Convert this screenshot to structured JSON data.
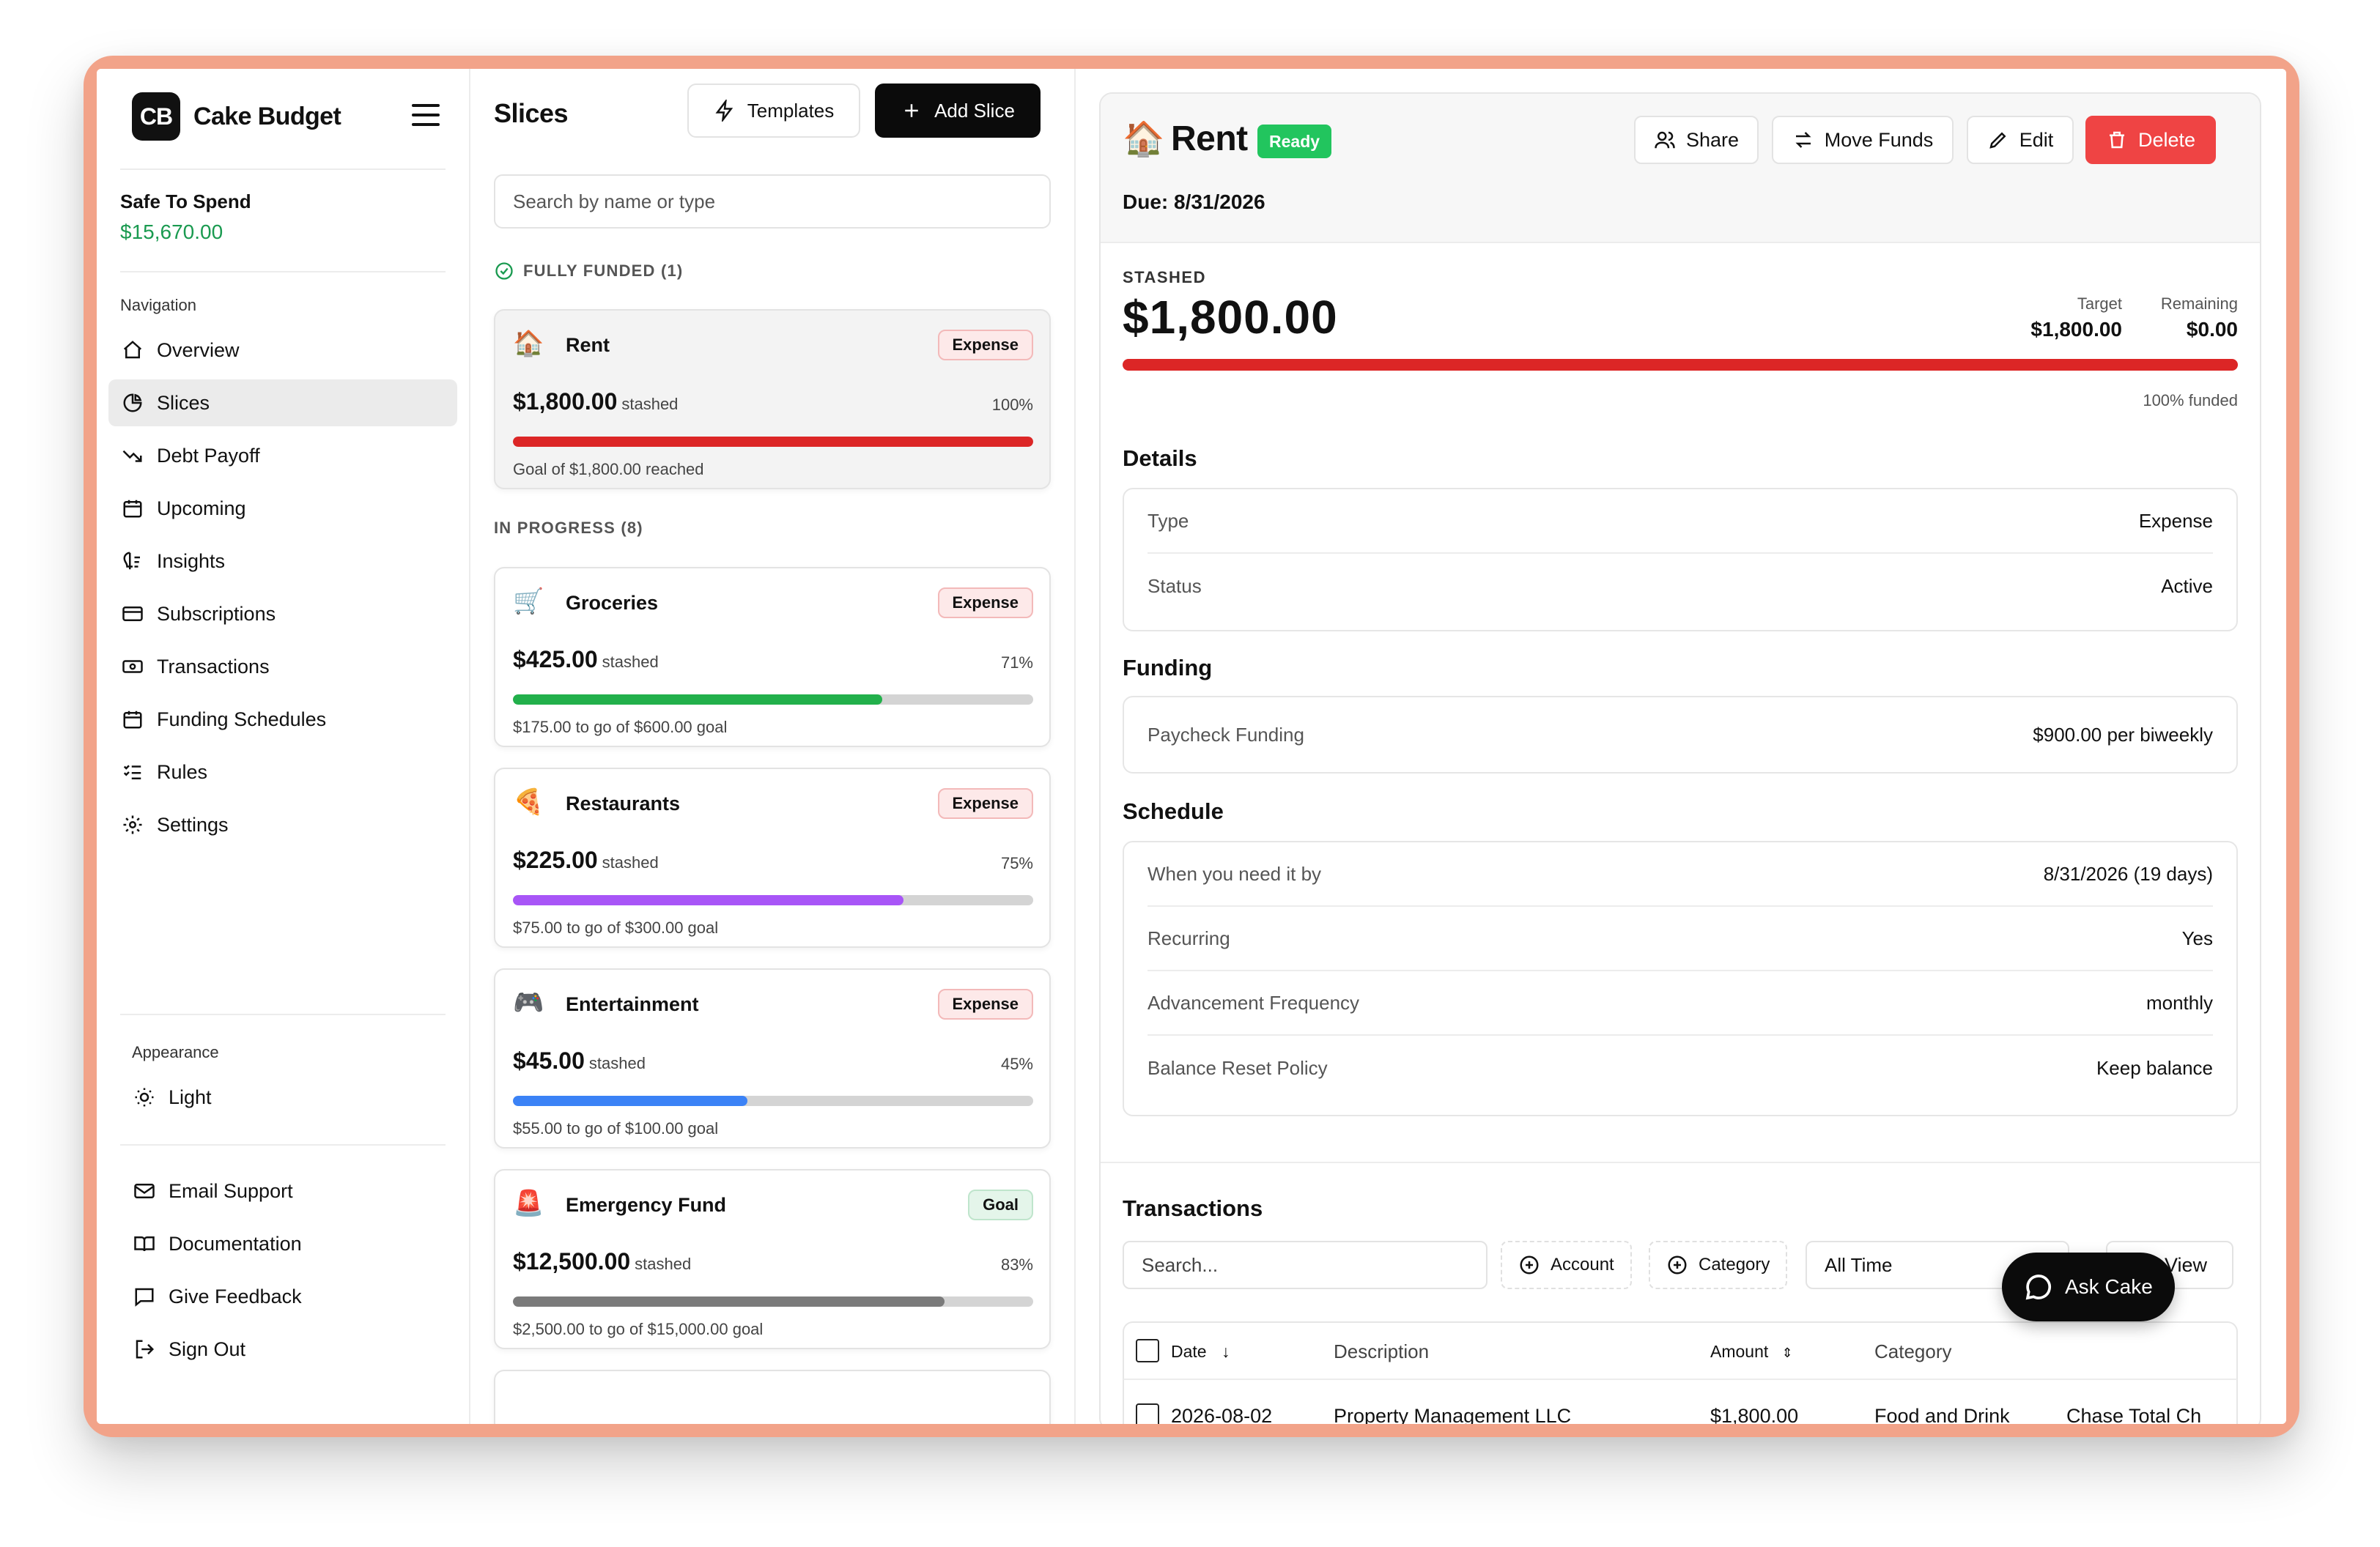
{
  "app": {
    "logo": "CB",
    "name": "Cake Budget"
  },
  "safe_to_spend": {
    "label": "Safe To Spend",
    "value": "$15,670.00"
  },
  "sidebar": {
    "nav_heading": "Navigation",
    "items": [
      {
        "label": "Overview",
        "icon": "home-icon"
      },
      {
        "label": "Slices",
        "icon": "pie-chart-icon",
        "active": true
      },
      {
        "label": "Debt Payoff",
        "icon": "trending-down-icon"
      },
      {
        "label": "Upcoming",
        "icon": "calendar-icon"
      },
      {
        "label": "Insights",
        "icon": "insights-icon"
      },
      {
        "label": "Subscriptions",
        "icon": "card-icon"
      },
      {
        "label": "Transactions",
        "icon": "banknote-icon"
      },
      {
        "label": "Funding Schedules",
        "icon": "calendar-icon"
      },
      {
        "label": "Rules",
        "icon": "list-check-icon"
      },
      {
        "label": "Settings",
        "icon": "gear-icon"
      }
    ],
    "appearance_heading": "Appearance",
    "theme_label": "Light",
    "bottom_items": [
      {
        "label": "Email Support",
        "icon": "mail-icon"
      },
      {
        "label": "Documentation",
        "icon": "book-icon"
      },
      {
        "label": "Give Feedback",
        "icon": "message-icon"
      },
      {
        "label": "Sign Out",
        "icon": "sign-out-icon"
      }
    ]
  },
  "slices": {
    "title": "Slices",
    "templates_label": "Templates",
    "add_label": "Add Slice",
    "search_placeholder": "Search by name or type",
    "fully_funded_label": "FULLY FUNDED (1)",
    "in_progress_label": "IN PROGRESS (8)",
    "cards": [
      {
        "emoji": "🏠",
        "name": "Rent",
        "badge": "Expense",
        "amount": "$1,800.00",
        "stashed": "stashed",
        "percent": "100%",
        "progress": 1.0,
        "color": "#dc2626",
        "note": "Goal of $1,800.00 reached"
      },
      {
        "emoji": "🛒",
        "name": "Groceries",
        "badge": "Expense",
        "amount": "$425.00",
        "stashed": "stashed",
        "percent": "71%",
        "progress": 0.71,
        "color": "#22b04b",
        "note": "$175.00 to go of $600.00 goal"
      },
      {
        "emoji": "🍕",
        "name": "Restaurants",
        "badge": "Expense",
        "amount": "$225.00",
        "stashed": "stashed",
        "percent": "75%",
        "progress": 0.75,
        "color": "#a855f7",
        "note": "$75.00 to go of $300.00 goal"
      },
      {
        "emoji": "🎮",
        "name": "Entertainment",
        "badge": "Expense",
        "amount": "$45.00",
        "stashed": "stashed",
        "percent": "45%",
        "progress": 0.45,
        "color": "#3b82f6",
        "note": "$55.00 to go of $100.00 goal"
      },
      {
        "emoji": "🚨",
        "name": "Emergency Fund",
        "badge": "Goal",
        "amount": "$12,500.00",
        "stashed": "stashed",
        "percent": "83%",
        "progress": 0.83,
        "color": "#7a7a7a",
        "note": "$2,500.00 to go of $15,000.00 goal"
      }
    ]
  },
  "detail": {
    "emoji": "🏠",
    "title": "Rent",
    "status_badge": "Ready",
    "due": "Due: 8/31/2026",
    "actions": {
      "share": "Share",
      "move": "Move Funds",
      "edit": "Edit",
      "delete": "Delete"
    },
    "stashed_label": "STASHED",
    "stashed_value": "$1,800.00",
    "target_label": "Target",
    "target_value": "$1,800.00",
    "remaining_label": "Remaining",
    "remaining_value": "$0.00",
    "progress": 1.0,
    "funded_note": "100% funded",
    "details_title": "Details",
    "details": [
      {
        "k": "Type",
        "v": "Expense"
      },
      {
        "k": "Status",
        "v": "Active"
      }
    ],
    "funding_title": "Funding",
    "funding": [
      {
        "k": "Paycheck Funding",
        "v": "$900.00 per biweekly"
      }
    ],
    "schedule_title": "Schedule",
    "schedule": [
      {
        "k": "When you need it by",
        "v": "8/31/2026 (19 days)"
      },
      {
        "k": "Recurring",
        "v": "Yes"
      },
      {
        "k": "Advancement Frequency",
        "v": "monthly"
      },
      {
        "k": "Balance Reset Policy",
        "v": "Keep balance"
      }
    ]
  },
  "transactions": {
    "title": "Transactions",
    "search_placeholder": "Search...",
    "account_chip": "Account",
    "category_chip": "Category",
    "range_value": "All Time",
    "view_label": "View",
    "columns": {
      "date": "Date",
      "description": "Description",
      "amount": "Amount",
      "category": "Category"
    },
    "rows": [
      {
        "date": "2026-08-02",
        "description": "Property Management LLC",
        "amount": "$1,800.00",
        "category": "Food and Drink",
        "account": "Chase Total Ch"
      }
    ]
  },
  "ask_cake": "Ask Cake"
}
